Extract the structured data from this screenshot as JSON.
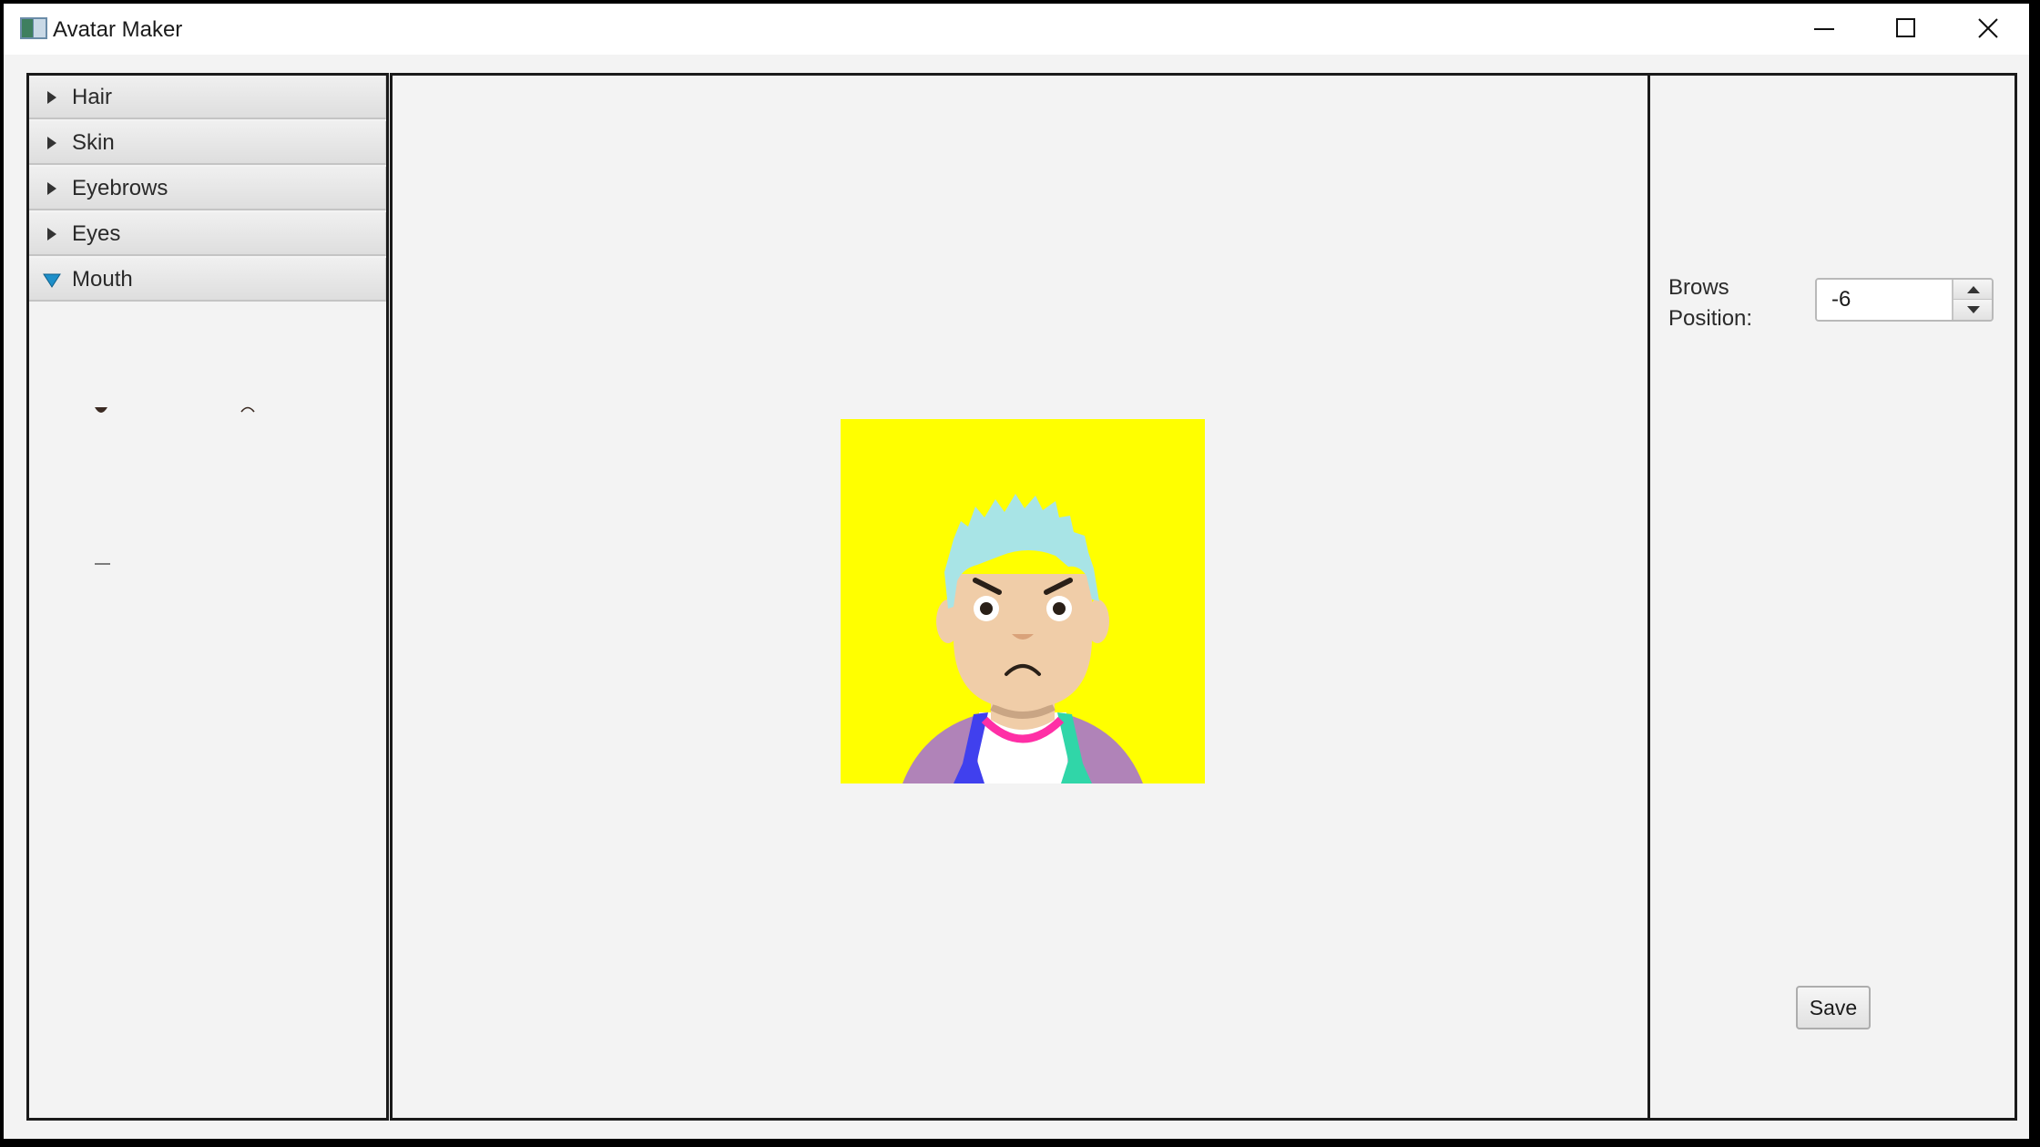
{
  "window": {
    "title": "Avatar Maker"
  },
  "sidebar": {
    "sections": [
      {
        "label": "Hair",
        "expanded": false
      },
      {
        "label": "Skin",
        "expanded": false
      },
      {
        "label": "Eyebrows",
        "expanded": false
      },
      {
        "label": "Eyes",
        "expanded": false
      },
      {
        "label": "Mouth",
        "expanded": true
      }
    ]
  },
  "controls": {
    "brows_position_label": "Brows Position:",
    "brows_position_value": "-6",
    "save_label": "Save"
  },
  "colors": {
    "avatar_background": "#ffff00",
    "hair": "#a8e4e6",
    "skin": "#f0cda8",
    "shirt_collar": "#ff2fa6",
    "jacket": "#b083b8",
    "lapel_left": "#4040ee",
    "lapel_right": "#30d6a8",
    "expand_arrow_active": "#1e8fc9"
  }
}
